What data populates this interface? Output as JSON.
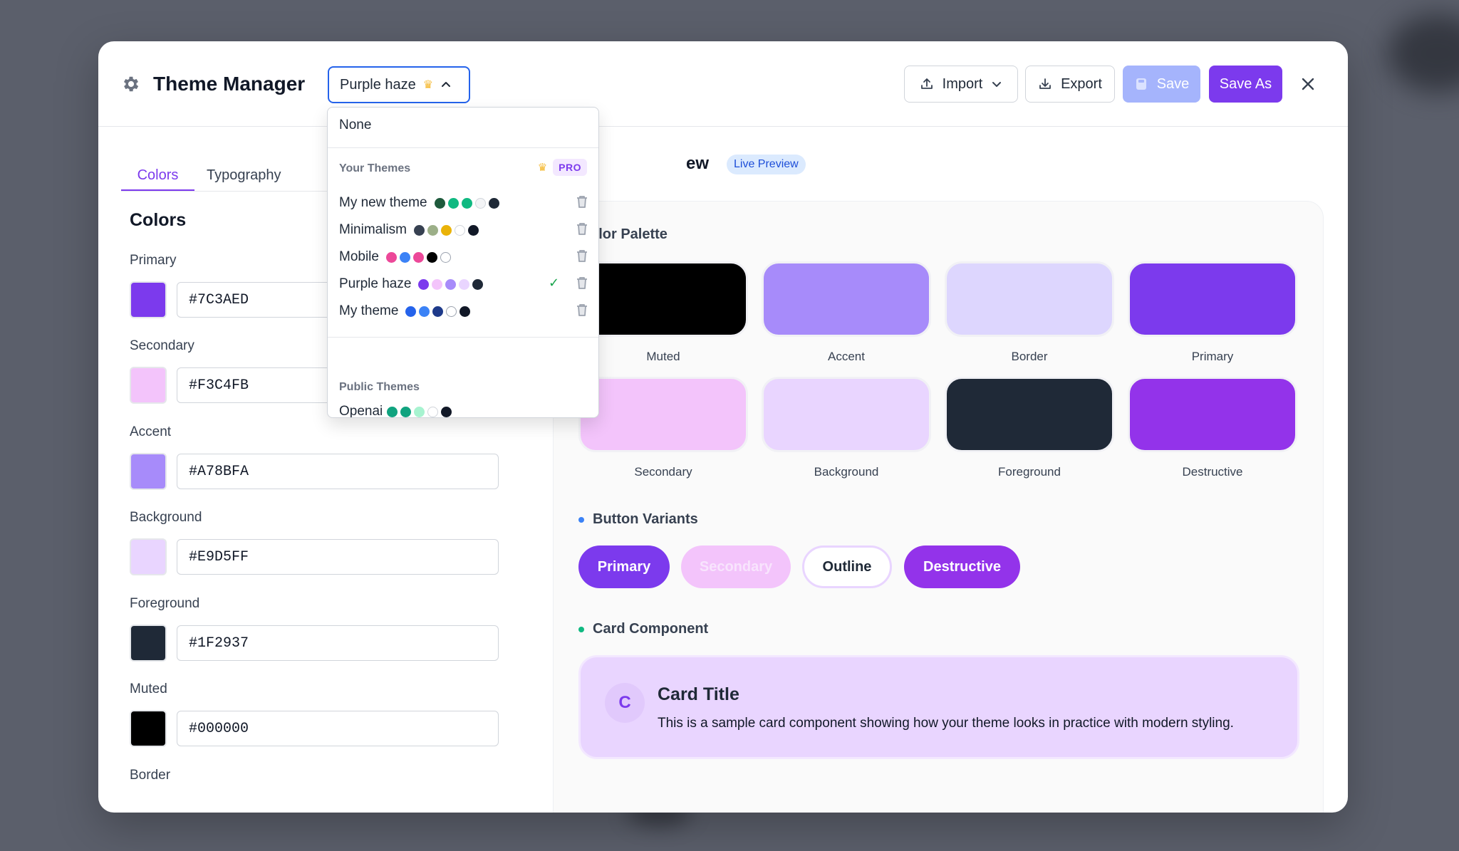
{
  "app": {
    "title": "Theme Manager"
  },
  "header": {
    "theme_selected": "Purple haze",
    "import_label": "Import",
    "export_label": "Export",
    "save_label": "Save",
    "save_as_label": "Save As"
  },
  "tabs": [
    {
      "label": "Colors",
      "active": true
    },
    {
      "label": "Typography",
      "active": false
    }
  ],
  "colors_panel": {
    "section_title": "Colors",
    "fields": [
      {
        "label": "Primary",
        "value": "#7C3AED"
      },
      {
        "label": "Secondary",
        "value": "#F3C4FB"
      },
      {
        "label": "Accent",
        "value": "#A78BFA"
      },
      {
        "label": "Background",
        "value": "#E9D5FF"
      },
      {
        "label": "Foreground",
        "value": "#1F2937"
      },
      {
        "label": "Muted",
        "value": "#000000"
      },
      {
        "label": "Border",
        "value": ""
      }
    ]
  },
  "preview": {
    "title_visible": "ew",
    "live_badge": "Live Preview",
    "palette_heading": "olor Palette",
    "palette": [
      {
        "label": "Muted",
        "color": "#000000"
      },
      {
        "label": "Accent",
        "color": "#A78BFA"
      },
      {
        "label": "Border",
        "color": "#DDD6FE"
      },
      {
        "label": "Primary",
        "color": "#7C3AED"
      },
      {
        "label": "Secondary",
        "color": "#F3C4FB"
      },
      {
        "label": "Background",
        "color": "#E9D5FF"
      },
      {
        "label": "Foreground",
        "color": "#1F2937"
      },
      {
        "label": "Destructive",
        "color": "#9333EA"
      }
    ],
    "button_variants_heading": "Button Variants",
    "buttons": {
      "primary": "Primary",
      "secondary": "Secondary",
      "outline": "Outline",
      "destructive": "Destructive"
    },
    "card_heading": "Card Component",
    "card": {
      "avatar_letter": "C",
      "title": "Card Title",
      "description": "This is a sample card component showing how your theme looks in practice with modern styling."
    }
  },
  "dropdown": {
    "none_label": "None",
    "your_themes_label": "Your Themes",
    "pro_label": "PRO",
    "themes": [
      {
        "name": "My new theme",
        "colors": [
          "#1E5A3C",
          "#10B981",
          "#10B981",
          "#F3F4F6",
          "#1F2937"
        ],
        "selected": false
      },
      {
        "name": "Minimalism",
        "colors": [
          "#374151",
          "#9CAF88",
          "#EAB308",
          "#FFFFFF",
          "#111827"
        ],
        "selected": false
      },
      {
        "name": "Mobile",
        "colors": [
          "#EC4899",
          "#3B82F6",
          "#EC4899",
          "#000000",
          "#FFFFFF"
        ],
        "selected": false
      },
      {
        "name": "Purple haze",
        "colors": [
          "#7C3AED",
          "#F3C4FB",
          "#A78BFA",
          "#E9D5FF",
          "#1F2937"
        ],
        "selected": true
      },
      {
        "name": "My theme",
        "colors": [
          "#2563EB",
          "#3B82F6",
          "#1E3A8A",
          "#FFFFFF",
          "#111827"
        ],
        "selected": false
      }
    ],
    "public_themes_label": "Public Themes",
    "cut_item": {
      "name": "Openai",
      "colors": [
        "#10A37F",
        "#10A37F",
        "#A7F3D0",
        "#FFFFFF",
        "#111827"
      ]
    }
  }
}
